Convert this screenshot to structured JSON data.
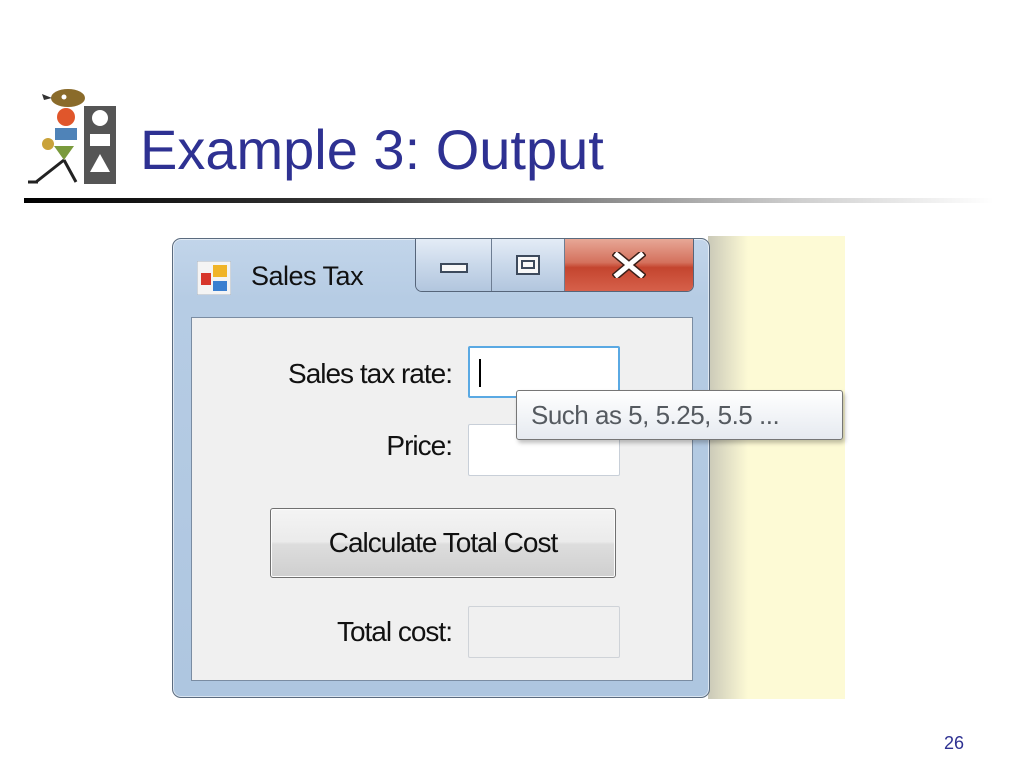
{
  "slide": {
    "title": "Example 3: Output",
    "page_number": "26",
    "logo_icon": "clipart-figures-icon"
  },
  "window": {
    "title": "Sales Tax",
    "icon": "form-app-icon",
    "caption_buttons": [
      "minimize-icon",
      "maximize-icon",
      "close-icon"
    ]
  },
  "form": {
    "sales_tax_rate_label": "Sales tax rate:",
    "sales_tax_rate_value": "",
    "price_label": "Price:",
    "price_value": "",
    "calculate_button_label": "Calculate Total Cost",
    "total_cost_label": "Total cost:",
    "total_cost_value": ""
  },
  "tooltip": {
    "text": "Such as 5, 5.25, 5.5 ..."
  },
  "colors": {
    "title_blue": "#2e3192",
    "close_red": "#c4452f",
    "focus_blue": "#5aa9e3",
    "background_yellow": "#fdfad5"
  }
}
